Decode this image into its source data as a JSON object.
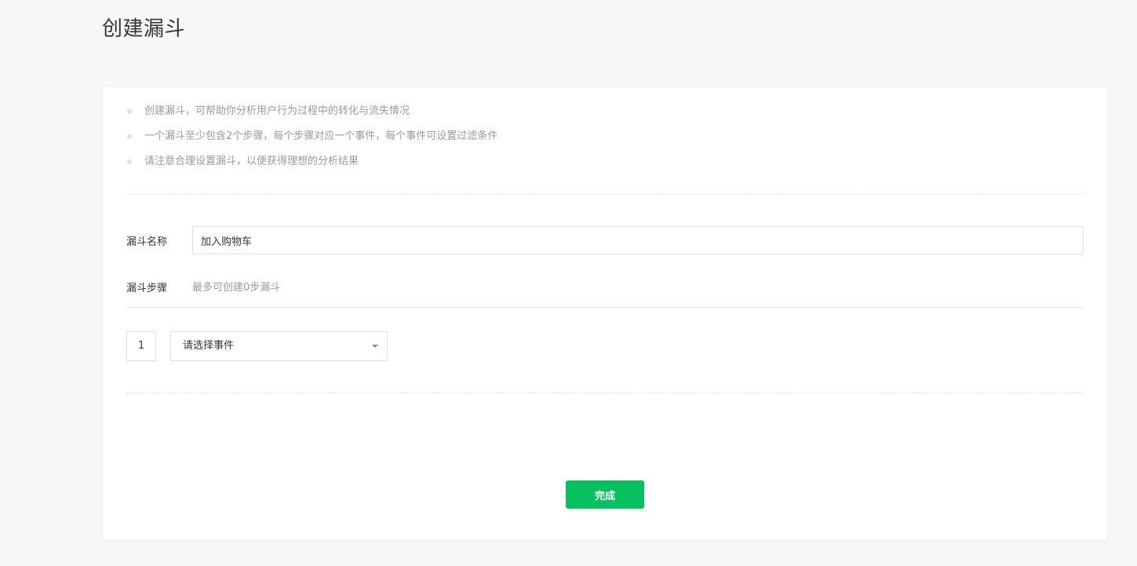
{
  "page": {
    "title": "创建漏斗"
  },
  "tips": [
    "创建漏斗，可帮助你分析用户行为过程中的转化与流失情况",
    "一个漏斗至少包含2个步骤，每个步骤对应一个事件，每个事件可设置过滤条件",
    "请注意合理设置漏斗，以便获得理想的分析结果"
  ],
  "form": {
    "name_label": "漏斗名称",
    "name_value": "加入购物车",
    "steps_label": "漏斗步骤",
    "steps_hint": "最多可创建0步漏斗"
  },
  "steps": [
    {
      "number": "1",
      "event_placeholder": "请选择事件"
    }
  ],
  "actions": {
    "done_label": "完成"
  },
  "colors": {
    "accent": "#07c160",
    "background": "#f6f7f9"
  },
  "icons": {
    "select_caret": "caret-down-icon",
    "bullet": "bullet-dot-icon"
  }
}
